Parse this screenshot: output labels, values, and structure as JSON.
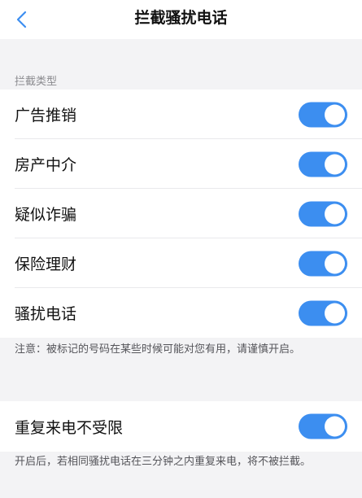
{
  "header": {
    "title": "拦截骚扰电话"
  },
  "section": {
    "label": "拦截类型"
  },
  "types": [
    {
      "label": "广告推销",
      "on": true
    },
    {
      "label": "房产中介",
      "on": true
    },
    {
      "label": "疑似诈骗",
      "on": true
    },
    {
      "label": "保险理财",
      "on": true
    },
    {
      "label": "骚扰电话",
      "on": true
    }
  ],
  "note1": "注意：被标记的号码在某些时候可能对您有用，请谨慎开启。",
  "repeat": {
    "label": "重复来电不受限",
    "on": true
  },
  "note2": "开启后，若相同骚扰电话在三分钟之内重复来电，将不被拦截。",
  "colors": {
    "accent": "#3c8ef0",
    "background": "#f3f3f5"
  },
  "icons": {
    "back": "chevron-left-icon"
  }
}
